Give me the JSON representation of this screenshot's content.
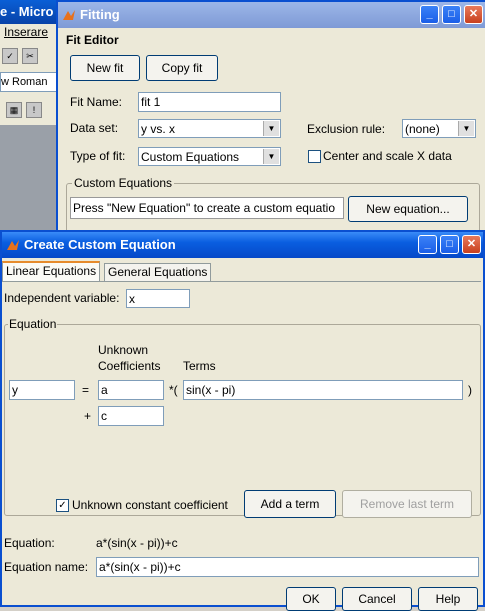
{
  "word": {
    "title": "e - Micro",
    "menu_item": "Inserare",
    "font": "w Roman"
  },
  "fitting": {
    "title": "Fitting",
    "header": "Fit Editor",
    "new_fit": "New fit",
    "copy_fit": "Copy fit",
    "fit_name_label": "Fit Name:",
    "fit_name_value": "fit 1",
    "data_set_label": "Data set:",
    "data_set_value": "y vs. x",
    "exclusion_label": "Exclusion rule:",
    "exclusion_value": "(none)",
    "type_label": "Type of fit:",
    "type_value": "Custom Equations",
    "center_scale_label": "Center and scale X data",
    "custom_group_label": "Custom Equations",
    "custom_hint": "Press \"New Equation\" to create a custom equatio",
    "new_equation": "New equation..."
  },
  "dialog": {
    "title": "Create Custom Equation",
    "tabs": [
      "Linear Equations",
      "General Equations"
    ],
    "indep_label": "Independent variable:",
    "indep_value": "x",
    "equation_group": "Equation",
    "unknown_coeff_line1": "Unknown",
    "unknown_coeff_line2": "Coefficients",
    "terms_label": "Terms",
    "lhs_value": "y",
    "equals": "=",
    "coeff_a": "a",
    "times_paren": "*(",
    "term_value": "sin(x - pi)",
    "close_paren": ")",
    "plus": "+",
    "coeff_c": "c",
    "unknown_const_label": "Unknown constant coefficient",
    "add_term": "Add a term",
    "remove_term": "Remove last term",
    "equation_label": "Equation:",
    "equation_value": "a*(sin(x - pi))+c",
    "equation_name_label": "Equation name:",
    "equation_name_value": "a*(sin(x - pi))+c",
    "ok": "OK",
    "cancel": "Cancel",
    "help": "Help"
  }
}
